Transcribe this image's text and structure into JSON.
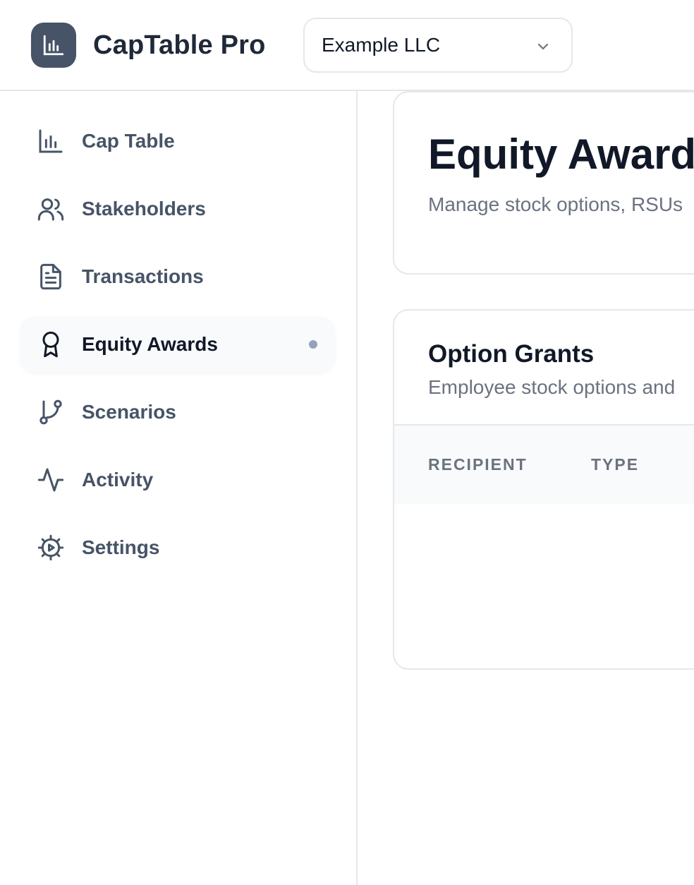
{
  "app": {
    "name": "CapTable Pro",
    "logo_icon": "bar-chart-icon"
  },
  "company_selector": {
    "value": "Example LLC",
    "icon": "chevron-down-icon"
  },
  "sidebar": {
    "items": [
      {
        "label": "Cap Table",
        "icon": "bar-chart-icon",
        "active": false
      },
      {
        "label": "Stakeholders",
        "icon": "users-icon",
        "active": false
      },
      {
        "label": "Transactions",
        "icon": "document-icon",
        "active": false
      },
      {
        "label": "Equity Awards",
        "icon": "award-icon",
        "active": true
      },
      {
        "label": "Scenarios",
        "icon": "git-branch-icon",
        "active": false
      },
      {
        "label": "Activity",
        "icon": "activity-icon",
        "active": false
      },
      {
        "label": "Settings",
        "icon": "settings-icon",
        "active": false
      }
    ]
  },
  "page": {
    "title": "Equity Awards",
    "subtitle": "Manage stock options, RSUs"
  },
  "grants": {
    "title": "Option Grants",
    "subtitle": "Employee stock options and",
    "columns": [
      "RECIPIENT",
      "TYPE"
    ]
  },
  "colors": {
    "logo_bg": "#475467",
    "active_dot": "#94a3b8",
    "nav_text": "#475467"
  }
}
